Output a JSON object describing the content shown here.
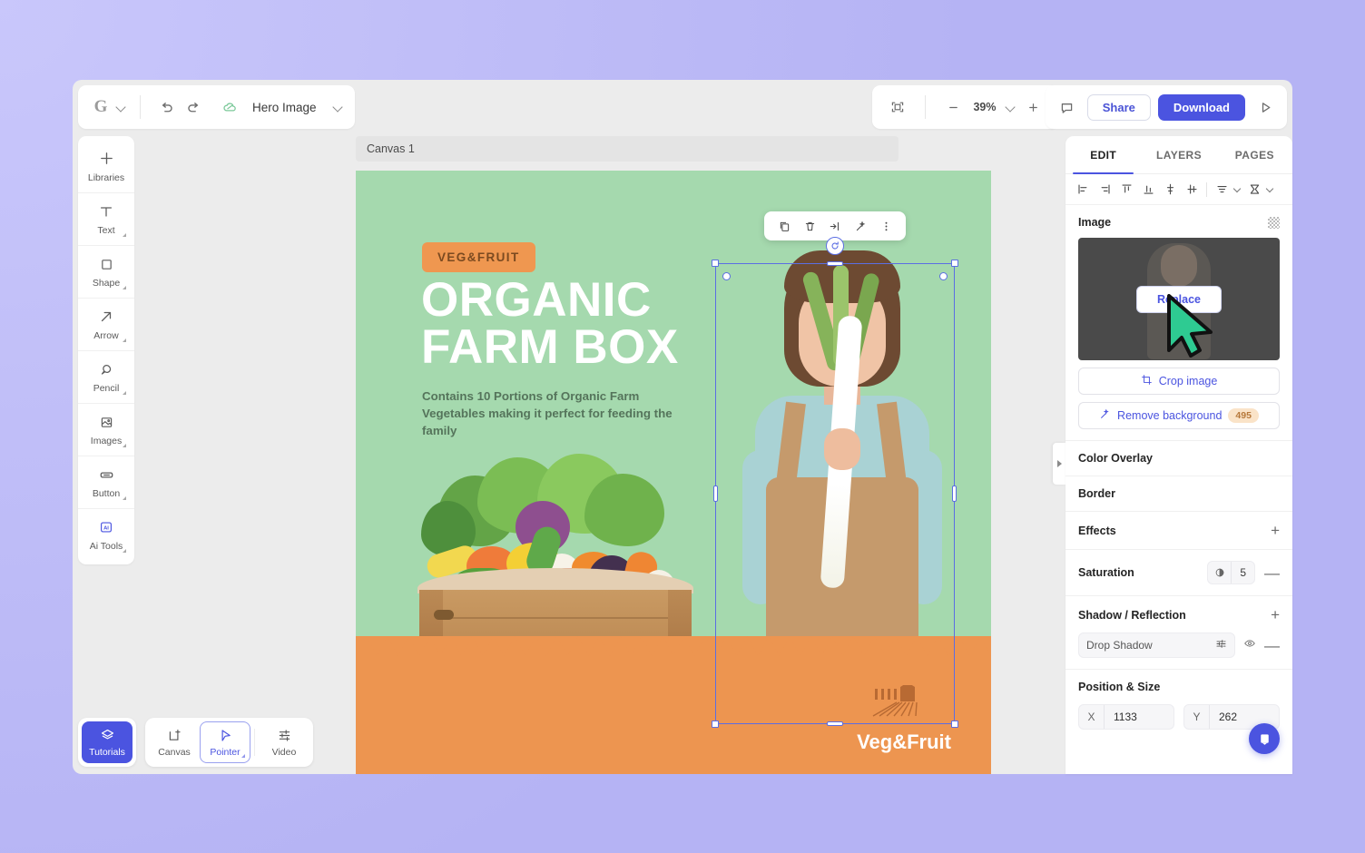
{
  "topbar": {
    "logo": "G",
    "undo_icon": "undo-icon",
    "redo_icon": "redo-icon",
    "cloud_icon": "cloud-saved-icon",
    "document_title": "Hero Image",
    "fit_icon": "fit-to-screen-icon",
    "zoom_out_label": "—",
    "zoom_level": "39%",
    "zoom_in_label": "+",
    "comment_icon": "comment-icon",
    "share_label": "Share",
    "download_label": "Download",
    "present_icon": "play-present-icon"
  },
  "tools": [
    {
      "label": "Libraries",
      "icon": "plus-icon",
      "expandable": false
    },
    {
      "label": "Text",
      "icon": "text-icon",
      "expandable": true
    },
    {
      "label": "Shape",
      "icon": "square-icon",
      "expandable": true
    },
    {
      "label": "Arrow",
      "icon": "arrow-icon",
      "expandable": true
    },
    {
      "label": "Pencil",
      "icon": "pencil-icon",
      "expandable": true
    },
    {
      "label": "Images",
      "icon": "image-icon",
      "expandable": true
    },
    {
      "label": "Button",
      "icon": "button-icon",
      "expandable": true
    },
    {
      "label": "Ai Tools",
      "icon": "ai-icon",
      "expandable": true
    }
  ],
  "canvas": {
    "tab_label": "Canvas 1",
    "float_toolbar": [
      "duplicate-icon",
      "delete-icon",
      "fit-crop-icon",
      "magic-wand-icon",
      "more-options-icon"
    ],
    "rotate_handle_icon": "rotate-icon"
  },
  "poster": {
    "badge": "VEG&FRUIT",
    "headline_line1": "ORGANIC",
    "headline_line2": "FARM BOX",
    "subhead": "Contains 10 Portions of Organic Farm Vegetables making it perfect for feeding the family",
    "brand": "Veg&Fruit",
    "farm_icon": "farm-field-icon",
    "colors": {
      "background": "#a5d9ae",
      "accent": "#ed9550",
      "headline": "#ffffff",
      "subhead": "#55745b"
    }
  },
  "right_panel": {
    "tabs": [
      {
        "label": "EDIT",
        "active": true
      },
      {
        "label": "LAYERS",
        "active": false
      },
      {
        "label": "PAGES",
        "active": false
      }
    ],
    "align_icons": [
      "align-left-icon",
      "align-right-icon",
      "align-top-icon",
      "align-bottom-icon",
      "distribute-vertical-icon",
      "distribute-horizontal-icon",
      "align-menu-icon",
      "arrange-menu-icon"
    ],
    "image_section": {
      "title": "Image",
      "transparency_icon": "checkerboard-icon",
      "replace_label": "Replace",
      "crop_label": "Crop image",
      "crop_icon": "crop-icon",
      "remove_bg_label": "Remove background",
      "remove_bg_icon": "magic-wand-icon",
      "remove_bg_credits": "495"
    },
    "color_overlay": {
      "title": "Color Overlay"
    },
    "border": {
      "title": "Border"
    },
    "effects": {
      "title": "Effects",
      "add_icon": "plus-icon"
    },
    "saturation": {
      "label": "Saturation",
      "icon": "contrast-icon",
      "value": "5",
      "remove_icon": "minus-icon"
    },
    "shadow_reflection": {
      "title": "Shadow / Reflection",
      "add_icon": "plus-icon",
      "item_label": "Drop Shadow",
      "settings_icon": "sliders-icon",
      "visibility_icon": "eye-icon",
      "remove_icon": "minus-icon"
    },
    "position_size": {
      "title": "Position & Size",
      "x_label": "X",
      "x_value": "1133",
      "y_label": "Y",
      "y_value": "262"
    },
    "collapse_icon": "panel-collapse-icon"
  },
  "bottombar": {
    "tutorials": {
      "label": "Tutorials",
      "icon": "layers-icon"
    },
    "items": [
      {
        "label": "Canvas",
        "icon": "canvas-icon",
        "selected": false
      },
      {
        "label": "Pointer",
        "icon": "pointer-icon",
        "selected": true
      },
      {
        "label": "Video",
        "icon": "video-timeline-icon",
        "selected": false
      }
    ],
    "chat_icon": "chat-support-icon"
  },
  "theme": {
    "accent": "#4b54e0",
    "page_bg": "#b7b6f5",
    "panel_bg": "#ffffff",
    "app_bg": "#ececec"
  }
}
